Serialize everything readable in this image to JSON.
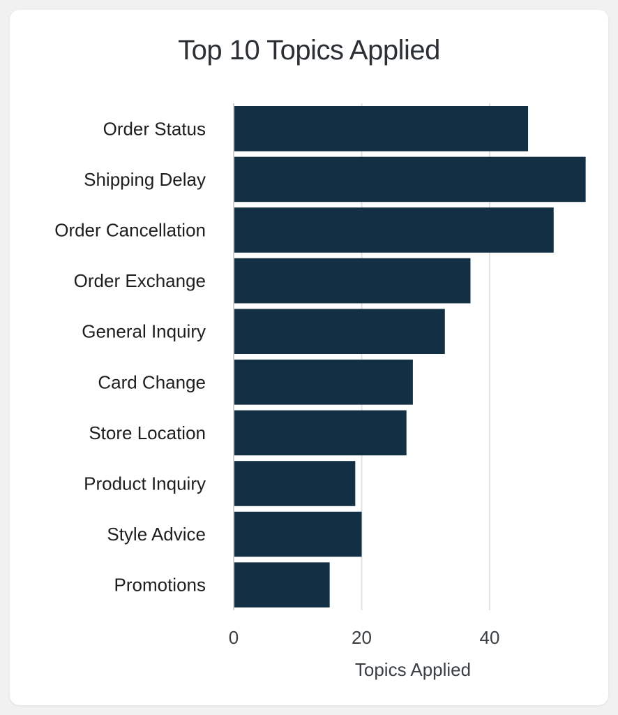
{
  "chart_data": {
    "type": "bar",
    "orientation": "horizontal",
    "title": "Top 10 Topics Applied",
    "xlabel": "Topics Applied",
    "ylabel": "",
    "categories": [
      "Order Status",
      "Shipping Delay",
      "Order Cancellation",
      "Order Exchange",
      "General Inquiry",
      "Card Change",
      "Store Location",
      "Product Inquiry",
      "Style Advice",
      "Promotions"
    ],
    "values": [
      46,
      55,
      50,
      37,
      33,
      28,
      27,
      19,
      20,
      15
    ],
    "xlim": [
      0,
      55
    ],
    "xticks": [
      0,
      20,
      40
    ],
    "xtick_labels": [
      "0",
      "20",
      "40"
    ],
    "grid": "vertical",
    "legend": "none",
    "bar_color": "#132f43",
    "grid_color": "#e2e2e2"
  }
}
